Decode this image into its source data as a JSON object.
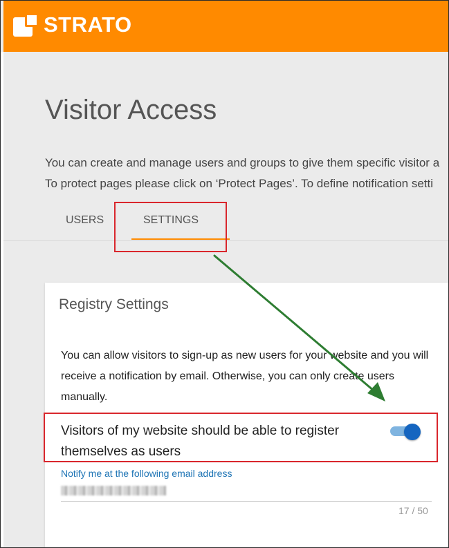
{
  "header": {
    "brand": "STRATO",
    "accent_color": "#ff8a00"
  },
  "page": {
    "title": "Visitor Access",
    "intro_line1": "You can create and manage users and groups to give them specific visitor a",
    "intro_line2": "To protect pages please click on ‘Protect Pages’. To define notification setti"
  },
  "tabs": [
    {
      "label": "USERS",
      "active": false
    },
    {
      "label": "SETTINGS",
      "active": true
    }
  ],
  "registry": {
    "title": "Registry Settings",
    "description": "You can allow visitors to sign-up as new users for your website and you will receive a notification by email. Otherwise, you can only create users manually.",
    "toggle_label": "Visitors of my website should be able to register themselves as users",
    "toggle_on": true,
    "toggle_color": "#1565c0",
    "email_label": "Notify me at the following email address",
    "email_counter": "17 / 50"
  },
  "annotations": {
    "highlight_color": "#d9262c",
    "arrow_color": "#2e7d32"
  }
}
